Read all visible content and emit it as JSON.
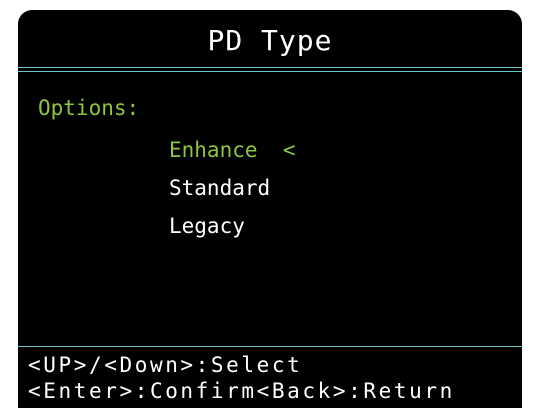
{
  "screen": {
    "title": "PD Type",
    "options_label": "Options:",
    "options": [
      {
        "label": "Enhance",
        "marker": "<",
        "selected": true
      },
      {
        "label": "Standard",
        "marker": "",
        "selected": false
      },
      {
        "label": "Legacy",
        "marker": "",
        "selected": false
      }
    ],
    "hints": [
      "<UP>/<Down>:Select",
      "<Enter>:Confirm<Back>:Return"
    ]
  },
  "colors": {
    "background": "#000000",
    "text": "#ffffff",
    "accent_green": "#8cc63f",
    "divider": "#6fc3c7"
  }
}
